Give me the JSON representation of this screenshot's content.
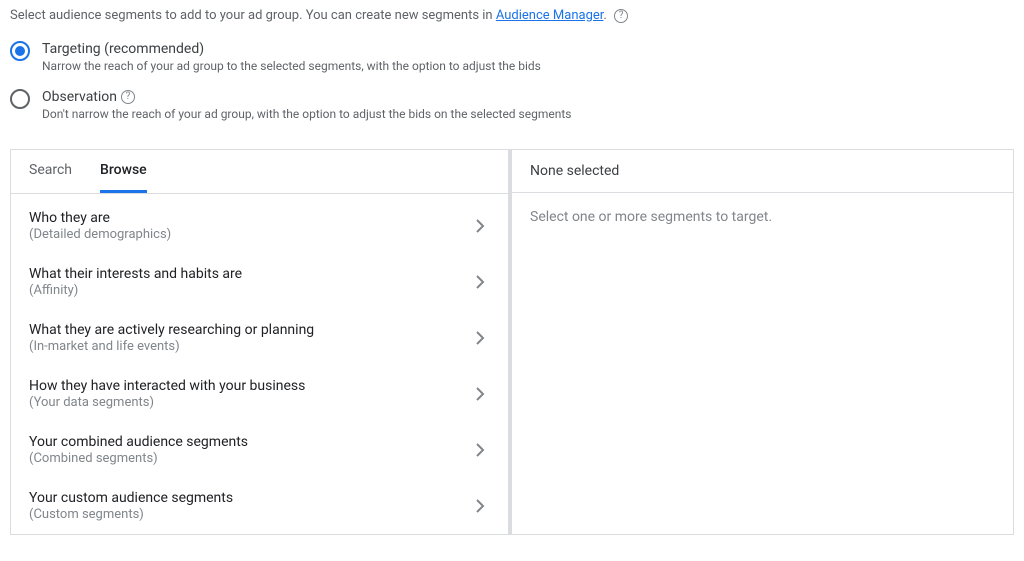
{
  "header": {
    "prefix": "Select audience segments to add to your ad group. You can create new segments in ",
    "link_text": "Audience Manager",
    "suffix": "."
  },
  "radios": {
    "targeting": {
      "label": "Targeting (recommended)",
      "description": "Narrow the reach of your ad group to the selected segments, with the option to adjust the bids"
    },
    "observation": {
      "label": "Observation",
      "description": "Don't narrow the reach of your ad group, with the option to adjust the bids on the selected segments"
    }
  },
  "tabs": {
    "search": "Search",
    "browse": "Browse"
  },
  "categories": [
    {
      "title": "Who they are",
      "sub": "(Detailed demographics)"
    },
    {
      "title": "What their interests and habits are",
      "sub": "(Affinity)"
    },
    {
      "title": "What they are actively researching or planning",
      "sub": "(In-market and life events)"
    },
    {
      "title": "How they have interacted with your business",
      "sub": "(Your data segments)"
    },
    {
      "title": "Your combined audience segments",
      "sub": "(Combined segments)"
    },
    {
      "title": "Your custom audience segments",
      "sub": "(Custom segments)"
    }
  ],
  "selection": {
    "header": "None selected",
    "body": "Select one or more segments to target."
  }
}
